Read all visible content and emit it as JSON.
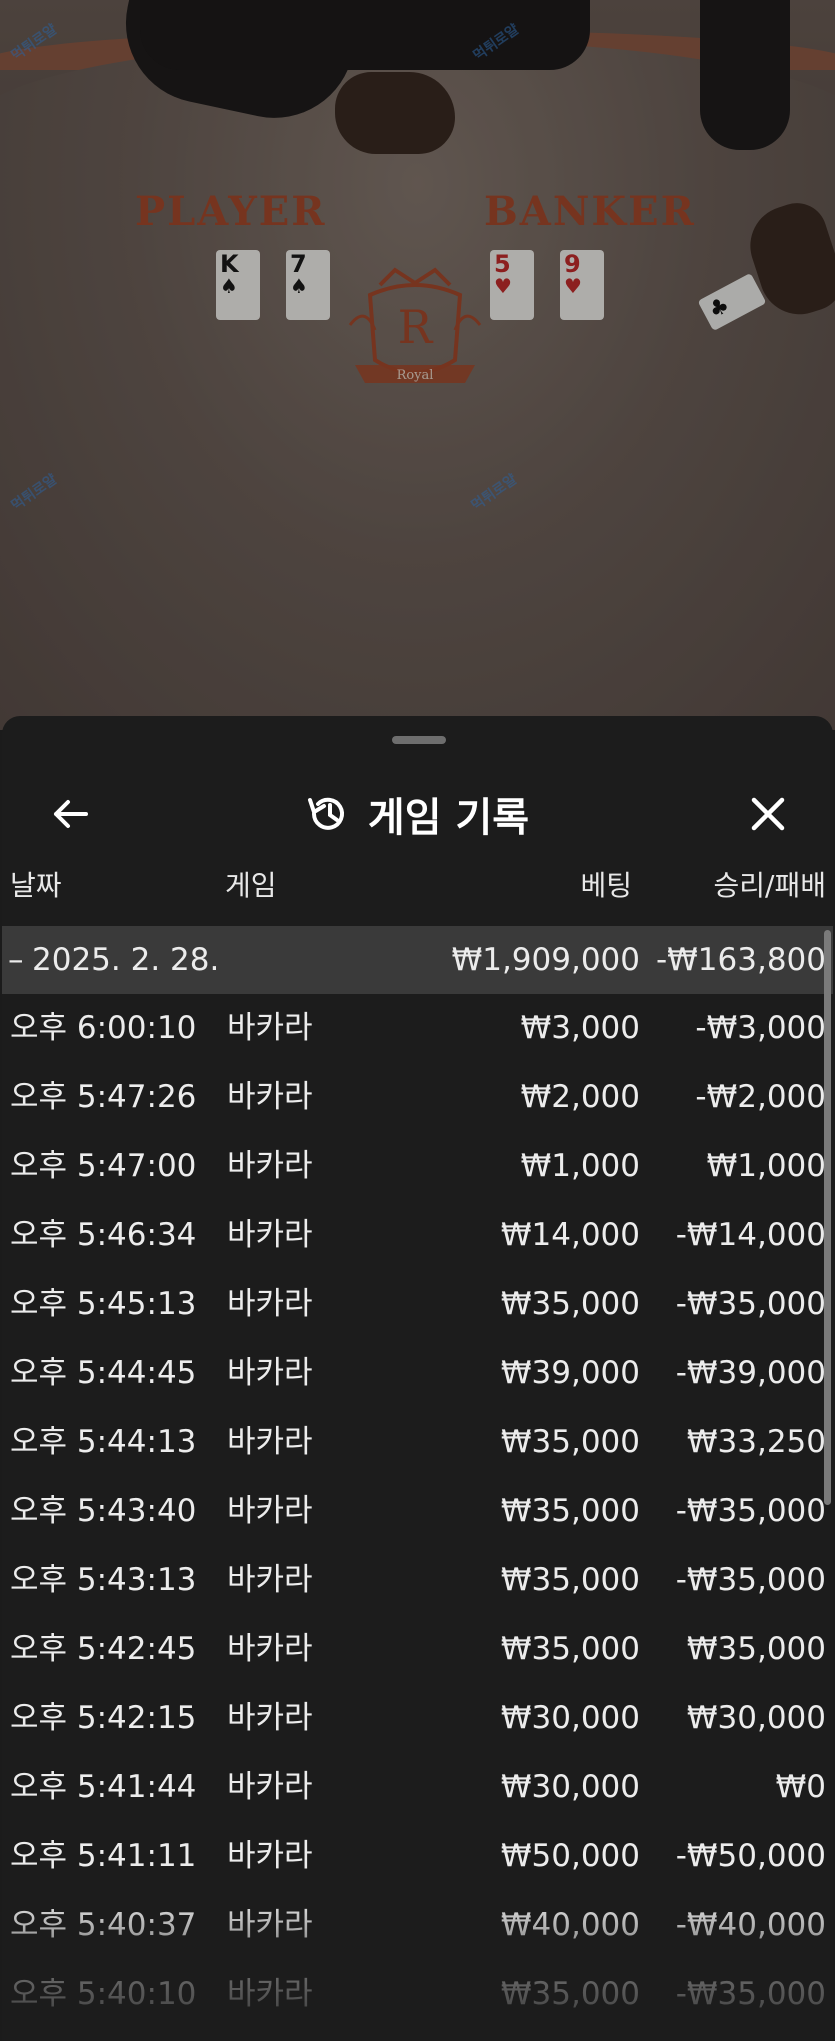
{
  "video": {
    "player_label": "PLAYER",
    "banker_label": "BANKER",
    "crest_letter": "R",
    "crest_text": "Royal",
    "player_cards": [
      {
        "rank": "K",
        "suit": "♠",
        "color": "black"
      },
      {
        "rank": "7",
        "suit": "♠",
        "color": "black"
      }
    ],
    "banker_cards": [
      {
        "rank": "5",
        "suit": "♥",
        "color": "red"
      },
      {
        "rank": "9",
        "suit": "♥",
        "color": "red"
      }
    ],
    "held_card": "♣",
    "watermark_text": "먹튀로얄",
    "brand_color": "#a4492c"
  },
  "sheet": {
    "title": "게임 기록",
    "back_icon": "arrow-left-icon",
    "history_icon": "history-clock-icon",
    "close_icon": "close-icon",
    "columns": {
      "date": "날짜",
      "game": "게임",
      "bet": "베팅",
      "result": "승리/패배"
    },
    "summary": {
      "date": "2025. 2. 28.",
      "bet": "₩1,909,000",
      "result": "-₩163,800"
    },
    "rows": [
      {
        "time": "오후 6:00:10",
        "game": "바카라",
        "bet": "₩3,000",
        "result": "-₩3,000"
      },
      {
        "time": "오후 5:47:26",
        "game": "바카라",
        "bet": "₩2,000",
        "result": "-₩2,000"
      },
      {
        "time": "오후 5:47:00",
        "game": "바카라",
        "bet": "₩1,000",
        "result": "₩1,000"
      },
      {
        "time": "오후 5:46:34",
        "game": "바카라",
        "bet": "₩14,000",
        "result": "-₩14,000"
      },
      {
        "time": "오후 5:45:13",
        "game": "바카라",
        "bet": "₩35,000",
        "result": "-₩35,000"
      },
      {
        "time": "오후 5:44:45",
        "game": "바카라",
        "bet": "₩39,000",
        "result": "-₩39,000"
      },
      {
        "time": "오후 5:44:13",
        "game": "바카라",
        "bet": "₩35,000",
        "result": "₩33,250"
      },
      {
        "time": "오후 5:43:40",
        "game": "바카라",
        "bet": "₩35,000",
        "result": "-₩35,000"
      },
      {
        "time": "오후 5:43:13",
        "game": "바카라",
        "bet": "₩35,000",
        "result": "-₩35,000"
      },
      {
        "time": "오후 5:42:45",
        "game": "바카라",
        "bet": "₩35,000",
        "result": "₩35,000"
      },
      {
        "time": "오후 5:42:15",
        "game": "바카라",
        "bet": "₩30,000",
        "result": "₩30,000"
      },
      {
        "time": "오후 5:41:44",
        "game": "바카라",
        "bet": "₩30,000",
        "result": "₩0"
      },
      {
        "time": "오후 5:41:11",
        "game": "바카라",
        "bet": "₩50,000",
        "result": "-₩50,000"
      },
      {
        "time": "오후 5:40:37",
        "game": "바카라",
        "bet": "₩40,000",
        "result": "-₩40,000"
      },
      {
        "time": "오후 5:40:10",
        "game": "바카라",
        "bet": "₩35,000",
        "result": "-₩35,000"
      }
    ]
  }
}
